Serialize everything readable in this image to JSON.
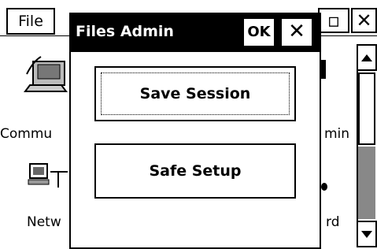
{
  "menubar": {
    "file_label": "File",
    "ok_short": "OK",
    "close_glyph": "✕"
  },
  "desktop": {
    "icons": [
      {
        "label": "Commu",
        "icon": "computer-phone-icon"
      },
      {
        "label": "Netw",
        "icon": "network-icon"
      },
      {
        "label": "min",
        "icon": "admin-icon"
      },
      {
        "label": "rd",
        "icon": "keyboard-icon"
      }
    ]
  },
  "dialog": {
    "title": "Files Admin",
    "ok_label": "OK",
    "close_glyph": "✕",
    "buttons": [
      {
        "label": "Save Session",
        "focused": true
      },
      {
        "label": "Safe Setup",
        "focused": false
      }
    ]
  },
  "scrollbar": {
    "up_icon": "▲",
    "down_icon": "▼"
  }
}
